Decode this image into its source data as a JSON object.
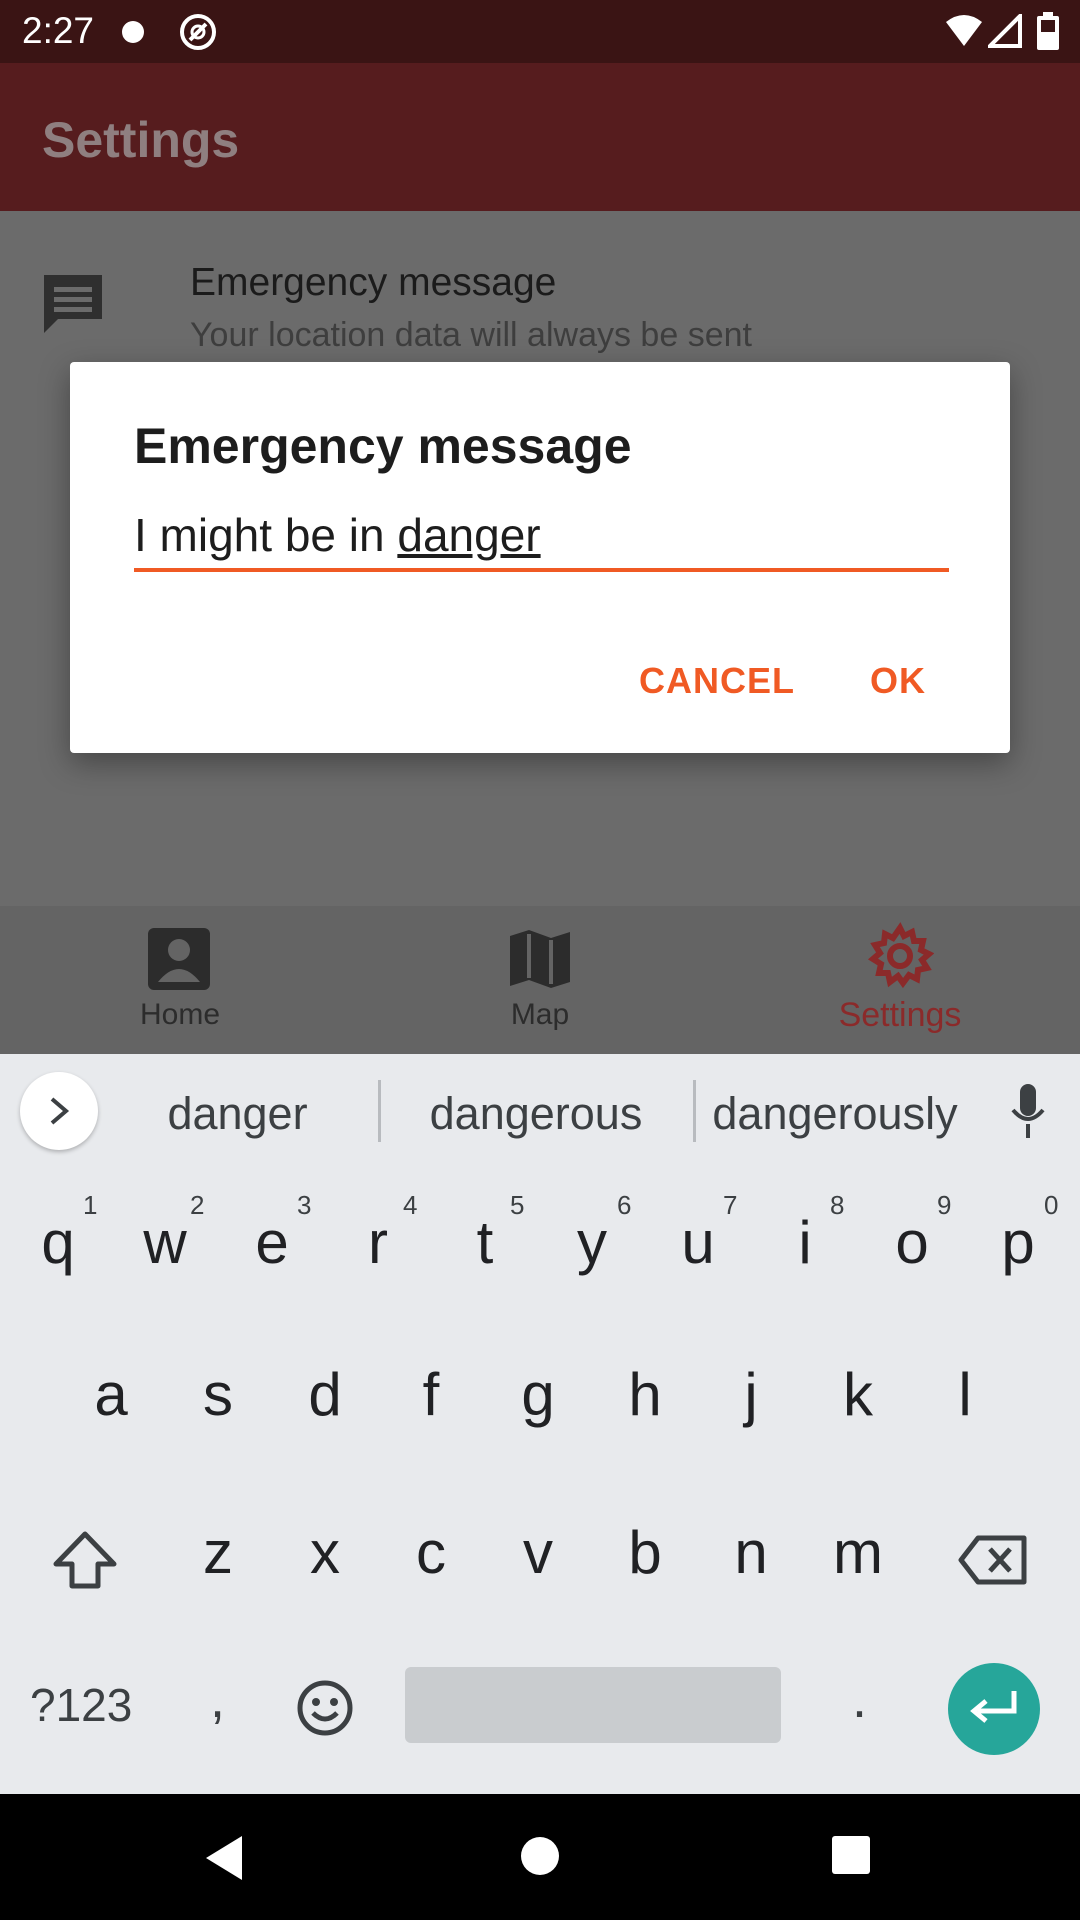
{
  "status_bar": {
    "time": "2:27"
  },
  "app_bar": {
    "title": "Settings"
  },
  "preference": {
    "title": "Emergency message",
    "subtitle": "Your location data will always be sent"
  },
  "dialog": {
    "title": "Emergency message",
    "input_prefix": "I might be in ",
    "input_underlined": "danger",
    "cancel_label": "CANCEL",
    "ok_label": "OK"
  },
  "bottom_nav": {
    "items": [
      {
        "label": "Home"
      },
      {
        "label": "Map"
      },
      {
        "label": "Settings"
      }
    ],
    "active_color": "#8b2a2a"
  },
  "keyboard": {
    "suggestions": [
      "danger",
      "dangerous",
      "dangerously"
    ],
    "row1": [
      "q",
      "w",
      "e",
      "r",
      "t",
      "y",
      "u",
      "i",
      "o",
      "p"
    ],
    "row1_hints": [
      "1",
      "2",
      "3",
      "4",
      "5",
      "6",
      "7",
      "8",
      "9",
      "0"
    ],
    "row2": [
      "a",
      "s",
      "d",
      "f",
      "g",
      "h",
      "j",
      "k",
      "l"
    ],
    "row3": [
      "z",
      "x",
      "c",
      "v",
      "b",
      "n",
      "m"
    ],
    "symbols_label": "?123",
    "comma": ",",
    "period": "."
  },
  "colors": {
    "accent": "#f05a24",
    "enter_key": "#26a69a"
  }
}
